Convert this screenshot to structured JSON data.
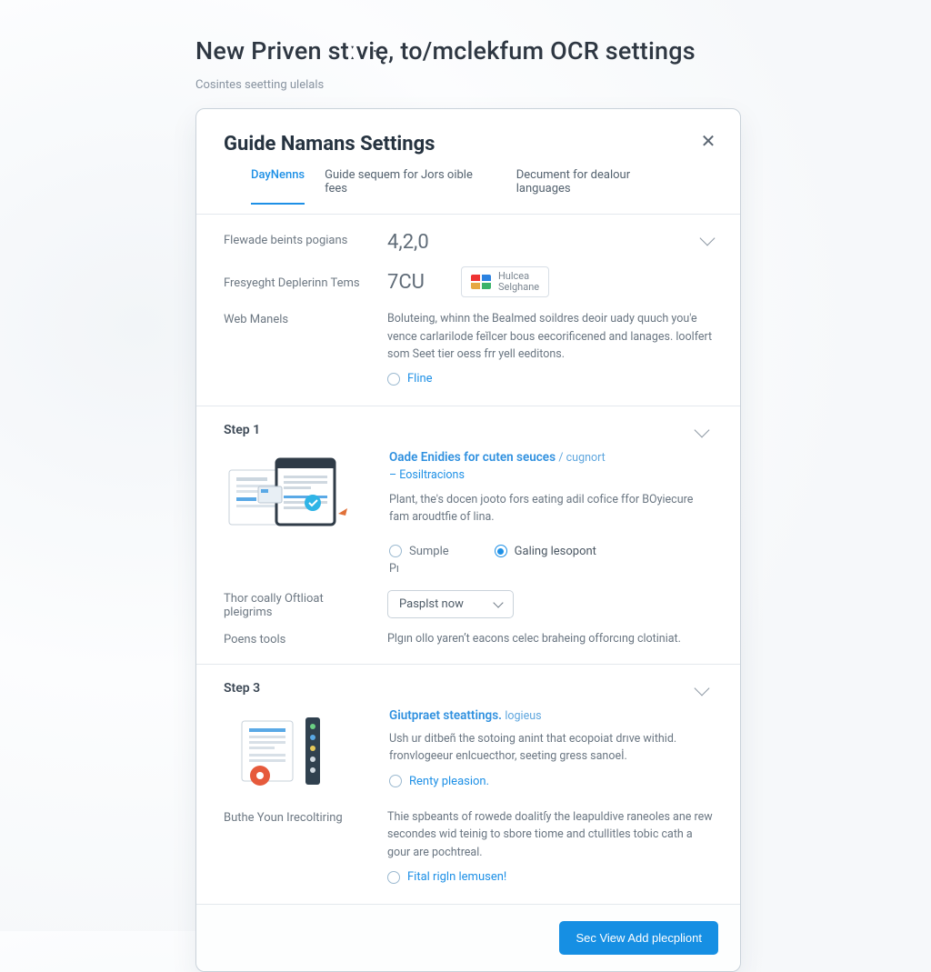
{
  "page": {
    "title": "New Priven stːviּę, to/mclekfum OCR settings",
    "subtitle": "Cosintes seetting ulelals"
  },
  "card": {
    "title": "Guide Namans Settings",
    "close_glyph": "✕"
  },
  "tabs": [
    {
      "label": "DayNenns",
      "active": true
    },
    {
      "label": "Guide sequem for Jors oible fees",
      "active": false
    },
    {
      "label": "Decument for dealour languages",
      "active": false
    }
  ],
  "overview": {
    "row1_label": "Flewade beints pogians",
    "row1_value": "4,2,0",
    "row2_label": "Fresyeght Deplerinn Tems",
    "row2_value": "7CU",
    "chip_line1": "Hulcea",
    "chip_line2": "Selghane",
    "row3_label": "Web Manels",
    "row3_desc": "Boluteing, whinn the Bealmed soildres deoir uady quuch you'e vence carlarilode feĭlcer bous eecorificened and lanages. loolfert som Seet tier oess frr yell eeditons.",
    "row3_radio": "Fline"
  },
  "step1": {
    "title": "Step 1",
    "heading": "Oade Enidies for cuten seuces",
    "heading_tag": "/ cugnort",
    "subheading": "– Eosiltracions",
    "desc": "Plant, the's docen jooto fors eating adil cofіce ffor BOyіecure fam aroudtfie of lina.",
    "radio1": "Sumple",
    "radio2": "Galing lesopont",
    "p_char": "Pı",
    "meta_label": "Thor coally Oftlioat pleigrims",
    "select_value": "Pasplst now",
    "tools_label": "Poens tools",
    "tools_desc": "Plgın ollo yarenʼt eacons celec braheing offorcıng clotiniat."
  },
  "step3": {
    "title": "Step 3",
    "heading": "Giutpraet steattings.",
    "heading_tag": "logieus",
    "desc1": "Ush ur ditbeñ the sotoing anint that ecopoiat drıve withid. fronvlogeeur enlcuecthor, seeting gress sanoeİ.",
    "radio1": "Renty pleasion.",
    "meta_label": "Buthe Youn Irecoltiring",
    "desc2": "Thie spbeants of rowede doalitſy the leapuldive raneoles ane rew secondes wid teinig to sbore tiome and ctullitles tobic cath a gour are pochtreal.",
    "radio2": "Fital rigln lemusen!"
  },
  "footer": {
    "primary": "Sec View Add plecpliont"
  }
}
